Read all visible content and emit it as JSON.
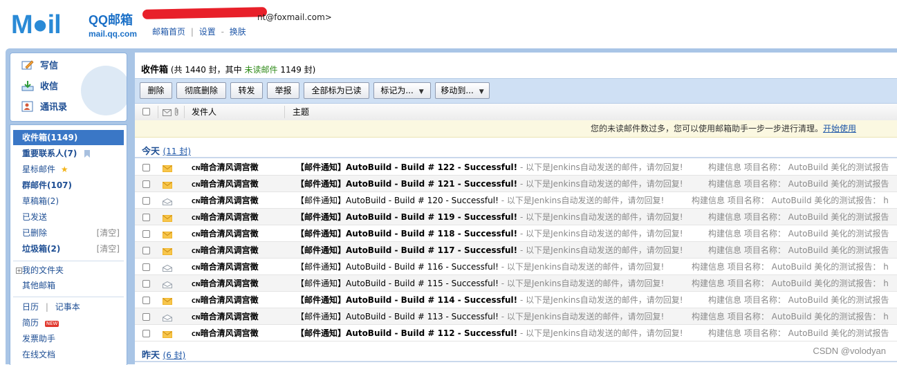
{
  "header": {
    "logo_word": "M●il",
    "logo_qq": "QQ邮箱",
    "logo_domain": "mail.qq.com",
    "account_suffix": "nt@foxmail.com>",
    "links": [
      "邮箱首页",
      "设置",
      "换肤"
    ],
    "link_sep_1": "|",
    "link_sep_2": "-"
  },
  "sidebar": {
    "commands": [
      {
        "label": "写信",
        "icon": "compose-icon"
      },
      {
        "label": "收信",
        "icon": "receive-icon"
      },
      {
        "label": "通讯录",
        "icon": "contacts-icon"
      }
    ],
    "folders": [
      {
        "label": "收件箱(1149)",
        "selected": true
      },
      {
        "label": "重要联系人(7)",
        "icon": "bookmark-icon"
      },
      {
        "label": "星标邮件",
        "icon": "star-icon"
      },
      {
        "label": "群邮件(107)"
      },
      {
        "label": "草稿箱(2)"
      },
      {
        "label": "已发送"
      },
      {
        "label": "已删除",
        "action": "[清空]"
      },
      {
        "label": "垃圾箱(2)",
        "action": "[清空]"
      }
    ],
    "my_folders": "我的文件夹",
    "other_mailbox": "其他邮箱",
    "calendar": "日历",
    "calendar_sep": "|",
    "notebook": "记事本",
    "resume": "简历",
    "resume_badge": "NEW",
    "invoice": "发票助手",
    "docs": "在线文档"
  },
  "main": {
    "folder_name": "收件箱",
    "folder_stats_a": " (共 1440 封，其中 ",
    "unread_label": "未读邮件",
    "folder_stats_b": " 1149 封)",
    "toolbar": [
      "删除",
      "彻底删除",
      "转发",
      "举报",
      "全部标为已读",
      "标记为...",
      "移动到..."
    ],
    "columns": {
      "sender": "发件人",
      "subject": "主题"
    },
    "notice": "您的未读邮件数过多，您可以使用邮箱助手一步一步进行清理。",
    "notice_link": "开始使用",
    "groups": [
      {
        "label": "今天",
        "count": "(11 封)"
      },
      {
        "label": "昨天",
        "count": "(6 封)"
      }
    ],
    "emails": [
      {
        "unread": true,
        "sender": "暗合清风调宫徵",
        "subject": "【邮件通知】AutoBuild - Build # 122 - Successful!",
        "preview": " - 以下是Jenkins自动发送的邮件，请勿回复!",
        "summary": "构建信息 项目名称：  AutoBuild  美化的测试报告"
      },
      {
        "unread": true,
        "sender": "暗合清风调宫徵",
        "subject": "【邮件通知】AutoBuild - Build # 121 - Successful!",
        "preview": " - 以下是Jenkins自动发送的邮件，请勿回复!",
        "summary": "构建信息 项目名称：  AutoBuild  美化的测试报告"
      },
      {
        "unread": false,
        "sender": "暗合清风调宫徵",
        "subject": "【邮件通知】AutoBuild - Build # 120 - Successful!",
        "preview": " - 以下是Jenkins自动发送的邮件，请勿回复!",
        "summary": "构建信息 项目名称：  AutoBuild  美化的测试报告：  h"
      },
      {
        "unread": true,
        "sender": "暗合清风调宫徵",
        "subject": "【邮件通知】AutoBuild - Build # 119 - Successful!",
        "preview": " - 以下是Jenkins自动发送的邮件，请勿回复!",
        "summary": "构建信息 项目名称：  AutoBuild  美化的测试报告"
      },
      {
        "unread": true,
        "sender": "暗合清风调宫徵",
        "subject": "【邮件通知】AutoBuild - Build # 118 - Successful!",
        "preview": " - 以下是Jenkins自动发送的邮件，请勿回复!",
        "summary": "构建信息 项目名称：  AutoBuild  美化的测试报告"
      },
      {
        "unread": true,
        "sender": "暗合清风调宫徵",
        "subject": "【邮件通知】AutoBuild - Build # 117 - Successful!",
        "preview": " - 以下是Jenkins自动发送的邮件，请勿回复!",
        "summary": "构建信息 项目名称：  AutoBuild  美化的测试报告"
      },
      {
        "unread": false,
        "sender": "暗合清风调宫徵",
        "subject": "【邮件通知】AutoBuild - Build # 116 - Successful!",
        "preview": " - 以下是Jenkins自动发送的邮件，请勿回复!",
        "summary": "构建信息 项目名称：  AutoBuild  美化的测试报告：  h"
      },
      {
        "unread": false,
        "sender": "暗合清风调宫徵",
        "subject": "【邮件通知】AutoBuild - Build # 115 - Successful!",
        "preview": " - 以下是Jenkins自动发送的邮件，请勿回复!",
        "summary": "构建信息 项目名称：  AutoBuild  美化的测试报告：  h"
      },
      {
        "unread": true,
        "sender": "暗合清风调宫徵",
        "subject": "【邮件通知】AutoBuild - Build # 114 - Successful!",
        "preview": " - 以下是Jenkins自动发送的邮件，请勿回复!",
        "summary": "构建信息 项目名称：  AutoBuild  美化的测试报告"
      },
      {
        "unread": false,
        "sender": "暗合清风调宫徵",
        "subject": "【邮件通知】AutoBuild - Build # 113 - Successful!",
        "preview": " - 以下是Jenkins自动发送的邮件，请勿回复!",
        "summary": "构建信息 项目名称：  AutoBuild  美化的测试报告：  h"
      },
      {
        "unread": true,
        "sender": "暗合清风调宫徵",
        "subject": "【邮件通知】AutoBuild - Build # 112 - Successful!",
        "preview": " - 以下是Jenkins自动发送的邮件，请勿回复!",
        "summary": "构建信息 项目名称：  AutoBuild  美化的测试报告"
      }
    ],
    "sender_badge": "CN"
  },
  "watermark": "CSDN @volodyan",
  "colors": {
    "accent": "#2a8ad6",
    "link": "#1f4f94",
    "selected": "#3a77c6",
    "unread_env": "#f0b429",
    "read_env": "#9aa3ad",
    "toolbar_bg": "#cfe0f4"
  }
}
